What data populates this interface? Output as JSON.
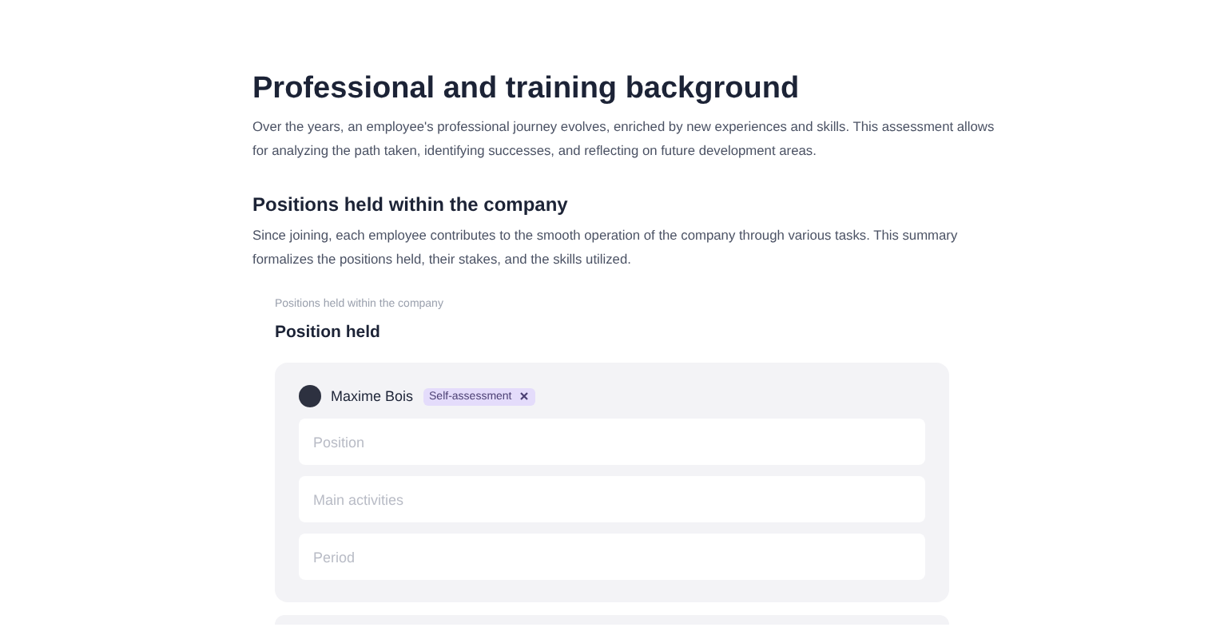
{
  "title": "Professional and training background",
  "intro": "Over the years, an employee's professional journey evolves, enriched by new experiences and skills. This assessment allows for analyzing the path taken, identifying successes, and reflecting on future development areas.",
  "section": {
    "heading": "Positions held within the company",
    "description": "Since joining, each employee contributes to the smooth operation of the company through various tasks. This summary formalizes the positions held, their stakes, and the skills utilized."
  },
  "question": {
    "caption": "Positions held within the company",
    "label": "Position held"
  },
  "entry": {
    "author": "Maxime Bois",
    "tag": "Self-assessment",
    "fields": [
      {
        "placeholder": "Position"
      },
      {
        "placeholder": "Main activities"
      },
      {
        "placeholder": "Period"
      }
    ]
  }
}
